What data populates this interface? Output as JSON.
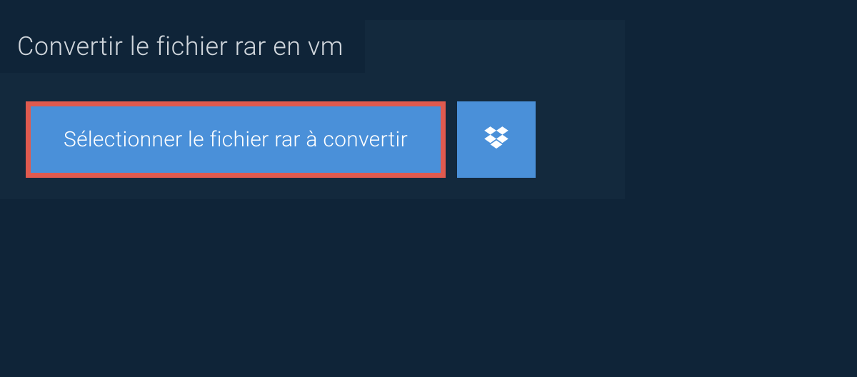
{
  "header": {
    "title": "Convertir le fichier rar en vm"
  },
  "buttons": {
    "select_file_label": "Sélectionner le fichier rar à convertir"
  },
  "colors": {
    "background": "#0f2438",
    "panel": "#13293d",
    "button_primary": "#4a90d9",
    "highlight_border": "#e05a4f",
    "text_light": "#d0d6dc"
  }
}
